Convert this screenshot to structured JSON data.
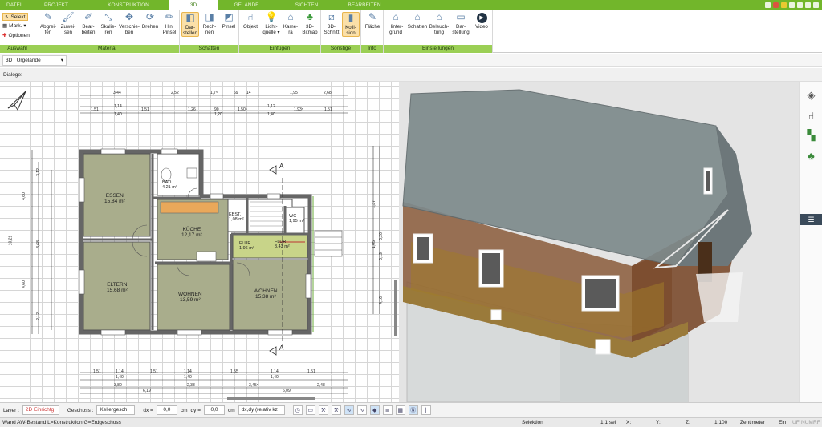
{
  "tabs": [
    "DATEI",
    "PROJEKT",
    "KONSTRUKTION",
    "3D",
    "GELÄNDE",
    "SICHTEN",
    "BEARBEITEN"
  ],
  "active_tab": "3D",
  "ribbon": {
    "auswahl": {
      "label": "Auswahl",
      "selekt": "Selekt",
      "mark": "Mark.",
      "optionen": "Optionen"
    },
    "material": {
      "label": "Material",
      "buttons": [
        "Abgrei-\nfen",
        "Zuwei-\nsen",
        "Bear-\nbeiten",
        "Skalie-\nren",
        "Verschie-\nben",
        "Drehen",
        "Hin.\nPinsel"
      ]
    },
    "schatten": {
      "label": "Schatten",
      "buttons": [
        "Dar-\nstellen",
        "Rech-\nnen",
        "Pinsel"
      ]
    },
    "einfuegen": {
      "label": "Einfügen",
      "buttons": [
        "Objekt",
        "Licht-\nquelle ▾",
        "Kame-\nra",
        "3D-\nBitmap"
      ]
    },
    "sonstige": {
      "label": "Sonstige",
      "buttons": [
        "3D-\nSchnitt",
        "Kolli-\nsion"
      ]
    },
    "info": {
      "label": "Info",
      "buttons": [
        "Fläche"
      ]
    },
    "einstellungen": {
      "label": "Einstellungen",
      "buttons": [
        "Hinter-\ngrund",
        "Schatten",
        "Beleuch-\ntung",
        "Dar-\nstellung",
        "Video"
      ]
    }
  },
  "view_selector": {
    "prefix": "3D",
    "value": "Urgelände"
  },
  "dialoge_label": "Dialoge:",
  "rooms": [
    {
      "name": "ESSEN",
      "area": "15,84 m²"
    },
    {
      "name": "BAD",
      "area": "4,21 m²"
    },
    {
      "name": "KÜCHE",
      "area": "12,17 m²"
    },
    {
      "name": "EBST.",
      "area": "1,08 m²"
    },
    {
      "name": "WC",
      "area": "1,95 m²"
    },
    {
      "name": "FLUR",
      "area": "1,96 m²"
    },
    {
      "name": "FLUR",
      "area": "3,43 m²"
    },
    {
      "name": "ELTERN",
      "area": "15,68 m²"
    },
    {
      "name": "WOHNEN",
      "area": "13,59 m²"
    },
    {
      "name": "WOHNEN",
      "area": "15,38 m²"
    }
  ],
  "dims_top1": [
    "3,44",
    "2,52",
    "1,7⁵",
    "69",
    "14",
    "1,95",
    "2,68"
  ],
  "dims_top2": [
    "1,51",
    "1,14",
    "1,51",
    "1,26",
    "90",
    "1,50⁵",
    "1,12",
    "1,93⁵",
    "1,51"
  ],
  "dims_top2b": [
    "1,40",
    "1,20",
    "1,40"
  ],
  "dims_bottom1": [
    "1,51",
    "1,14",
    "1,51",
    "1,14",
    "1,55",
    "1,14",
    "1,51"
  ],
  "dims_bottom1b": [
    "1,40",
    "1,40",
    "1,40"
  ],
  "dims_bottom2": [
    "3,80",
    "2,38",
    "3,45⁵",
    "2,48"
  ],
  "dims_bottom3": [
    "6,19",
    "6,09"
  ],
  "dims_left": [
    "3,12",
    "4,60",
    "10,21",
    "3,68",
    "4,60",
    "2,12"
  ],
  "dims_right": [
    "1,37",
    "3,20",
    "1,05",
    "3,19",
    "4,16"
  ],
  "section_label": "A",
  "props": {
    "layer_label": "Layer :",
    "layer_value": "2D Einrichtg",
    "geschoss_label": "Geschoss :",
    "geschoss_value": "Kellergesch",
    "dx_label": "dx =",
    "dx_value": "0,0",
    "unit1": "cm",
    "dy_label": "dy =",
    "dy_value": "0,0",
    "unit2": "cm",
    "mode": "dx,dy (relativ kz"
  },
  "status": {
    "left": "Wand AW-Bestand L=Konstruktion G=Erdgeschoss",
    "mode": "Selektion",
    "scale": "1:1 sel",
    "x": "X:",
    "y": "Y:",
    "z": "Z:",
    "ratio": "1:100",
    "unit": "Zentimeter",
    "ein": "Ein",
    "uf": "UF",
    "num": "NUM",
    "rf": "RF"
  },
  "colors": {
    "ribbon_green": "#72b62b",
    "group_label": "#9bcf55",
    "room_fill": "#a9ad8c",
    "wall": "#6b6b6b",
    "roof": "#7e8a8c",
    "brick": "#8a5a3a"
  }
}
